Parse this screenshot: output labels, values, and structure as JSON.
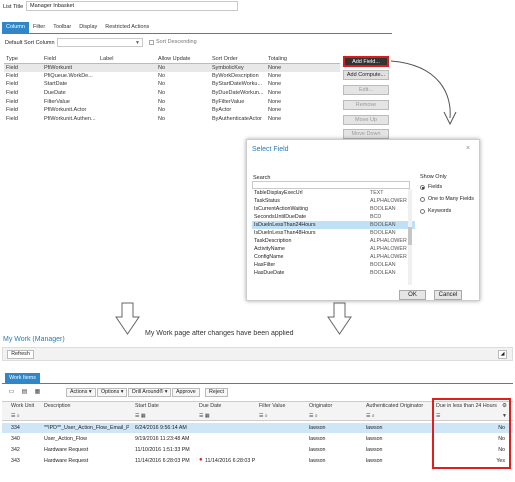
{
  "list_config": {
    "list_title_label": "List Title",
    "list_title_value": "Manager Inbasket",
    "tabs": [
      "Column",
      "Filter",
      "Toolbar",
      "Display",
      "Restricted Actions"
    ],
    "active_tab": "Column",
    "default_sort_label": "Default Sort Column",
    "sort_descending_label": "Sort Descending",
    "columns_headers": [
      "Type",
      "Field",
      "Label",
      "Allow Update",
      "Sort Order",
      "Totaling"
    ],
    "rows": [
      [
        "Field",
        "PfiWorkunit",
        "",
        "No",
        "SymbolicKey",
        "None"
      ],
      [
        "Field",
        "PfiQueue.WorkDe...",
        "",
        "No",
        "ByWorkDescription",
        "None"
      ],
      [
        "Field",
        "StartDate",
        "",
        "No",
        "ByStartDateWorku...",
        "None"
      ],
      [
        "Field",
        "DueDate",
        "",
        "No",
        "ByDueDateWorkun...",
        "None"
      ],
      [
        "Field",
        "FilterValue",
        "",
        "No",
        "ByFilterValue",
        "None"
      ],
      [
        "Field",
        "PfiWorkunit.Actor",
        "",
        "No",
        "ByActor",
        "None"
      ],
      [
        "Field",
        "PfiWorkunit.Authen...",
        "",
        "No",
        "ByAuthenticateActor",
        "None"
      ]
    ],
    "side_buttons": [
      "Add Field...",
      "Add Compute...",
      "Edit...",
      "Remove",
      "Move Up",
      "Move Down"
    ]
  },
  "select_field_dialog": {
    "title": "Select Field",
    "close_glyph": "×",
    "search_label": "Search",
    "fields": [
      [
        "TableDisplayExecUrl",
        "TEXT"
      ],
      [
        "TaskStatus",
        "ALPHALOWER"
      ],
      [
        "IsCurrentActionWaiting",
        "BOOLEAN"
      ],
      [
        "SecondsUntilDueDate",
        "BCD"
      ],
      [
        "IsDueInLessThan24Hours",
        "BOOLEAN"
      ],
      [
        "IsDueInLessThan48Hours",
        "BOOLEAN"
      ],
      [
        "TaskDescription",
        "ALPHALOWER"
      ],
      [
        "ActivityName",
        "ALPHALOWER"
      ],
      [
        "ConfigName",
        "ALPHALOWER"
      ],
      [
        "HasFilter",
        "BOOLEAN"
      ],
      [
        "HasDueDate",
        "BOOLEAN"
      ]
    ],
    "selected_index": 4,
    "show_only_label": "Show Only",
    "radio_options": [
      "Fields",
      "One to Many Fields",
      "Keywords"
    ],
    "radio_selected": "Fields",
    "ok_label": "OK",
    "cancel_label": "Cancel"
  },
  "annotation": "My Work page after changes have been applied",
  "my_work": {
    "title": "My Work (Manager)",
    "refresh_label": "Refresh",
    "collapse_glyph": "◢",
    "work_items_tab": "Work Items",
    "toolbar": [
      "Actions",
      "Options",
      "Drill Around®",
      "Approve",
      "Reject"
    ],
    "headers": [
      "Work Unit",
      "Description",
      "Start Date",
      "Due Date",
      "Filter Value",
      "Originator",
      "Authenticated Originator",
      "Due in less than 24 Hours"
    ],
    "rows": [
      {
        "work_unit": "334",
        "description": "**IPD**_User_Action_Flow_Email_P",
        "start_date": "6/24/2016 9:56:14 AM",
        "due_date": "",
        "filter_value": "",
        "originator": "lawson",
        "auth": "lawson",
        "due24": "No"
      },
      {
        "work_unit": "340",
        "description": "User_Action_Flow",
        "start_date": "9/19/2016 11:23:48 AM",
        "due_date": "",
        "filter_value": "",
        "originator": "lawson",
        "auth": "lawson",
        "due24": "No"
      },
      {
        "work_unit": "342",
        "description": "Hardware Request",
        "start_date": "11/10/2016 1:51:33 PM",
        "due_date": "",
        "filter_value": "",
        "originator": "lawson",
        "auth": "lawson",
        "due24": "No"
      },
      {
        "work_unit": "343",
        "description": "Hardware Request",
        "start_date": "11/14/2016 6:28:03 PM",
        "due_date": "11/14/2016 6:28:03 P",
        "filter_value": "",
        "originator": "lawson",
        "auth": "lawson",
        "due24": "Yes"
      }
    ],
    "selected_row": 0
  },
  "colors": {
    "accent": "#2f86c8",
    "highlight": "#e01e1e",
    "selected_row": "#cfe6f6"
  }
}
